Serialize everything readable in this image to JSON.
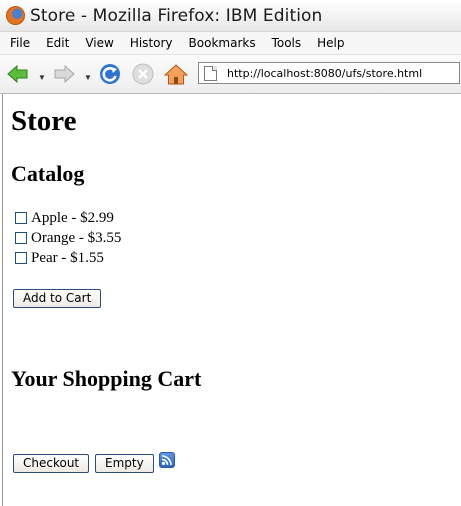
{
  "window": {
    "title": "Store - Mozilla Firefox: IBM Edition"
  },
  "menu": {
    "items": [
      {
        "label": "File"
      },
      {
        "label": "Edit"
      },
      {
        "label": "View"
      },
      {
        "label": "History"
      },
      {
        "label": "Bookmarks"
      },
      {
        "label": "Tools"
      },
      {
        "label": "Help"
      }
    ]
  },
  "toolbar": {
    "url": "http://localhost:8080/ufs/store.html",
    "icons": [
      "back-icon",
      "forward-icon",
      "reload-icon",
      "stop-icon",
      "home-icon",
      "page-icon"
    ]
  },
  "page": {
    "title": "Store",
    "catalog_heading": "Catalog",
    "catalog_items": [
      {
        "label": "Apple - $2.99",
        "checked": false
      },
      {
        "label": "Orange - $3.55",
        "checked": false
      },
      {
        "label": "Pear - $1.55",
        "checked": false
      }
    ],
    "add_to_cart_label": "Add to Cart",
    "cart_heading": "Your Shopping Cart",
    "checkout_label": "Checkout",
    "empty_label": "Empty",
    "feed_icon": "rss-feed-icon"
  },
  "colors": {
    "firefox_orange": "#e2731f",
    "back_arrow": "#4caf32",
    "reload_blue": "#2f74d0",
    "home_orange": "#e87b2a",
    "rss_blue": "#3f75d2"
  }
}
